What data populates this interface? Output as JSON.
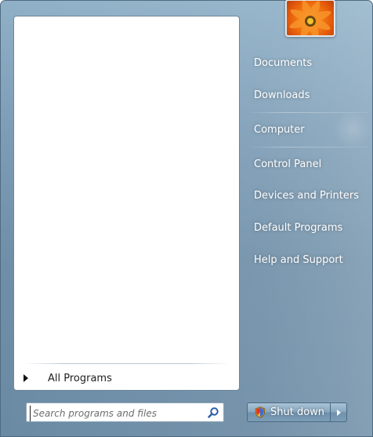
{
  "right_pane": {
    "items": [
      {
        "label": "Documents"
      },
      {
        "label": "Downloads"
      },
      {
        "label": "Computer"
      },
      {
        "label": "Control Panel"
      },
      {
        "label": "Devices and Printers"
      },
      {
        "label": "Default Programs"
      },
      {
        "label": "Help and Support"
      }
    ]
  },
  "left_pane": {
    "all_programs_label": "All Programs"
  },
  "search": {
    "placeholder": "Search programs and files"
  },
  "shutdown": {
    "label": "Shut down"
  },
  "icons": {
    "user_picture": "orange-flower-image",
    "search": "search-icon",
    "shield": "shield-icon",
    "expand": "chevron-right-icon"
  },
  "colors": {
    "accent_blue": "#6f8fa8",
    "panel_white": "#ffffff",
    "flower_orange": "#f27a12"
  }
}
